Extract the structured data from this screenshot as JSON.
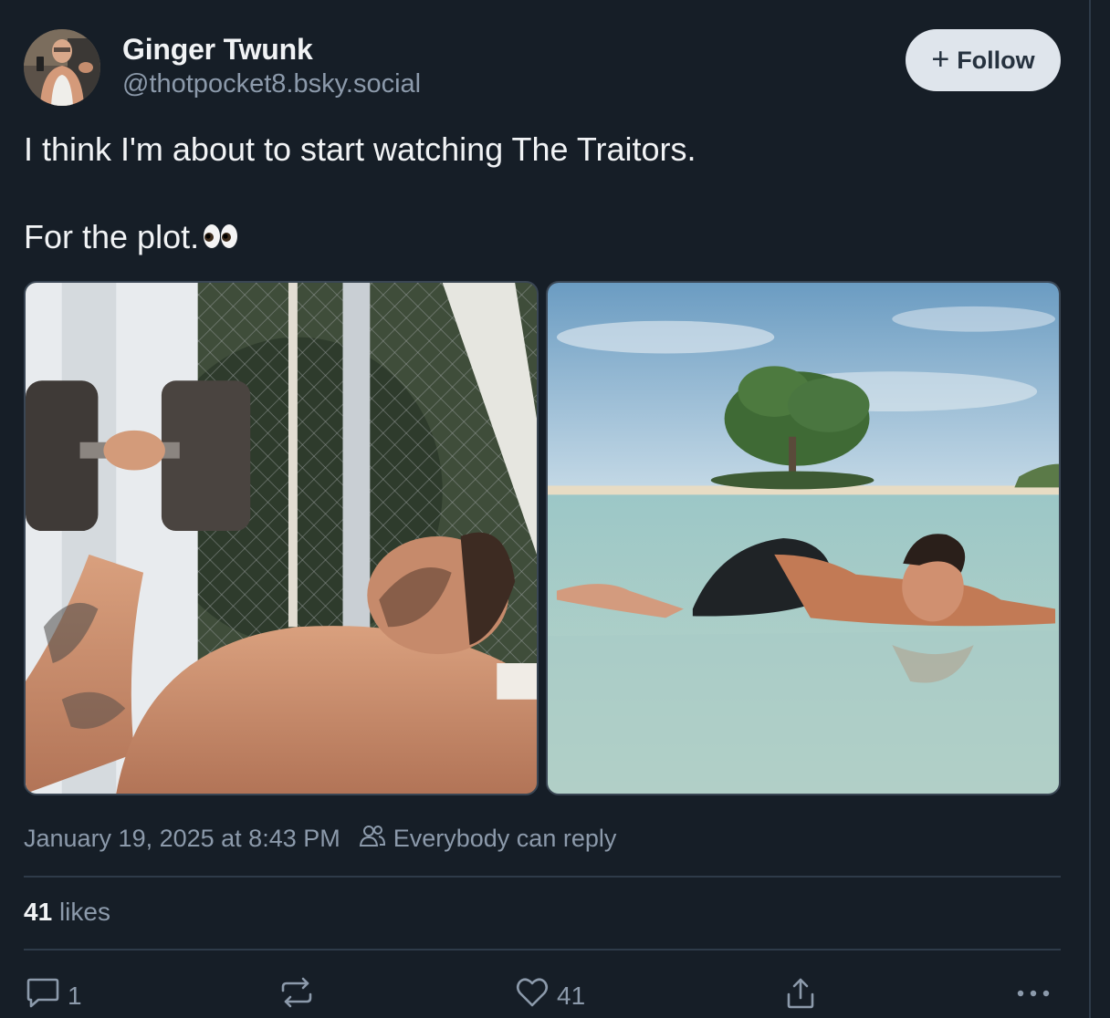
{
  "author": {
    "display_name": "Ginger Twunk",
    "handle": "@thotpocket8.bsky.social",
    "avatar_icon": "avatar-photo"
  },
  "follow_button": {
    "label": "Follow",
    "icon": "plus-icon"
  },
  "post": {
    "line1": "I think I'm about to start watching The Traitors.",
    "line2": "For the plot.",
    "emoji": "eyes-emoji",
    "images": [
      {
        "alt_icon": "photo-man-lifting-dumbbell"
      },
      {
        "alt_icon": "photo-man-lying-in-shallow-water"
      }
    ]
  },
  "meta": {
    "timestamp": "January 19, 2025 at 8:43 PM",
    "reply_setting": "Everybody can reply",
    "reply_icon": "people-icon"
  },
  "stats": {
    "likes_count": "41",
    "likes_label": "likes"
  },
  "actions": {
    "reply_count": "1",
    "repost_count": "",
    "like_count": "41"
  },
  "colors": {
    "background": "#161e27",
    "muted_text": "#8c9aab",
    "divider": "#2e3b49",
    "follow_bg": "#dfe5ec"
  }
}
